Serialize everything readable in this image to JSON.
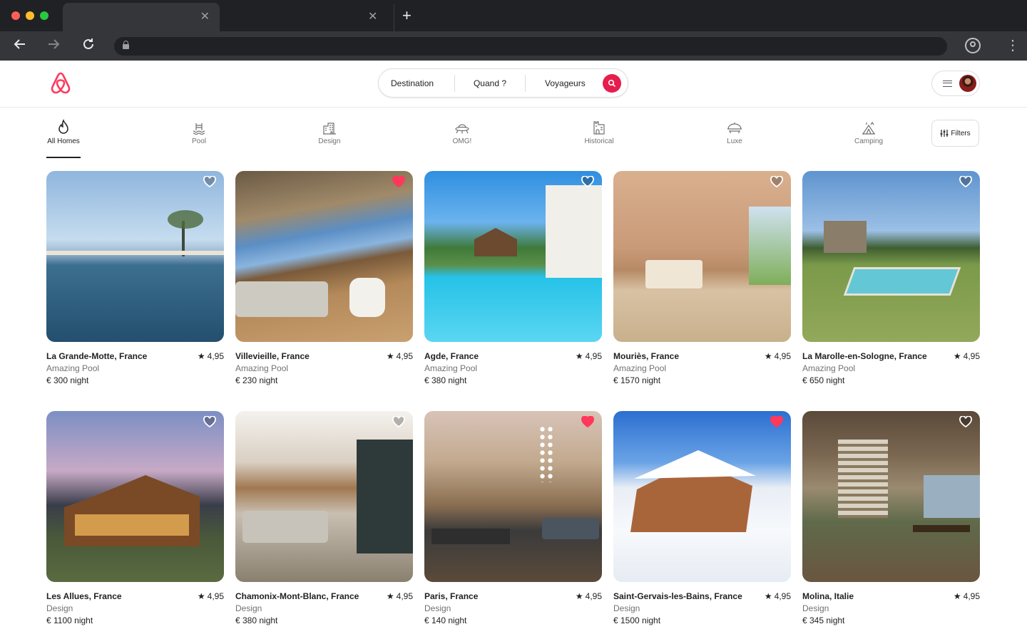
{
  "search": {
    "destination": "Destination",
    "when": "Quand ?",
    "guests": "Voyageurs"
  },
  "categories": [
    {
      "label": "All Homes",
      "icon": "fire-icon"
    },
    {
      "label": "Pool",
      "icon": "pool-icon"
    },
    {
      "label": "Design",
      "icon": "building-icon"
    },
    {
      "label": "OMG!",
      "icon": "ufo-icon"
    },
    {
      "label": "Historical",
      "icon": "castle-icon"
    },
    {
      "label": "Luxe",
      "icon": "luxe-icon"
    },
    {
      "label": "Camping",
      "icon": "tent-icon"
    }
  ],
  "filters_label": "Filters",
  "listings": [
    {
      "title": "La Grande-Motte, France",
      "rating": "4,95",
      "type": "Amazing Pool",
      "price": "€ 300 night",
      "liked": false
    },
    {
      "title": "Villevieille, France",
      "rating": "4,95",
      "type": "Amazing Pool",
      "price": "€ 230 night",
      "liked": true
    },
    {
      "title": "Agde, France",
      "rating": "4,95",
      "type": "Amazing Pool",
      "price": "€ 380 night",
      "liked": false
    },
    {
      "title": "Mouriès, France",
      "rating": "4,95",
      "type": "Amazing Pool",
      "price": "€ 1570 night",
      "liked": false
    },
    {
      "title": "La Marolle-en-Sologne, France",
      "rating": "4,95",
      "type": "Amazing Pool",
      "price": "€ 650 night",
      "liked": false
    },
    {
      "title": "Les Allues, France",
      "rating": "4,95",
      "type": "Design",
      "price": "€ 1100 night",
      "liked": false
    },
    {
      "title": "Chamonix-Mont-Blanc, France",
      "rating": "4,95",
      "type": "Design",
      "price": "€ 380 night",
      "liked": false
    },
    {
      "title": "Paris, France",
      "rating": "4,95",
      "type": "Design",
      "price": "€ 140 night",
      "liked": true
    },
    {
      "title": "Saint-Gervais-les-Bains, France",
      "rating": "4,95",
      "type": "Design",
      "price": "€ 1500 night",
      "liked": true
    },
    {
      "title": "Molina, Italie",
      "rating": "4,95",
      "type": "Design",
      "price": "€ 345 night",
      "liked": false
    }
  ],
  "colors": {
    "brand": "#ff385c",
    "search_button": "#e61e4d",
    "liked_heart": "#ff385c"
  }
}
